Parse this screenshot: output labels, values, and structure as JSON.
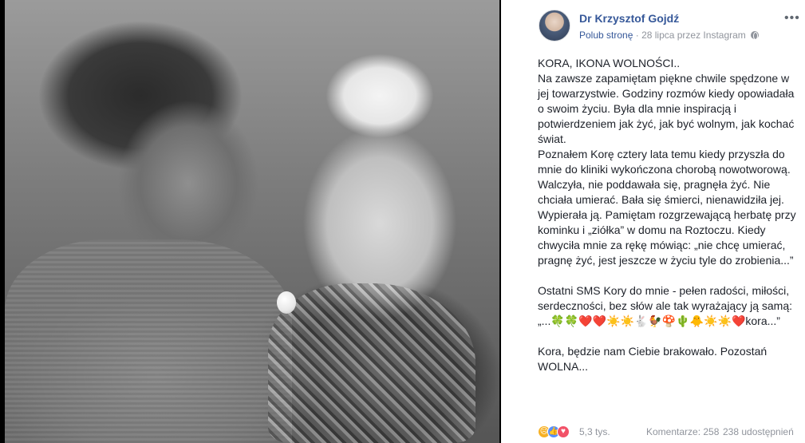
{
  "post": {
    "page_name": "Dr Krzysztof Gojdź",
    "like_page_label": "Polub stronę",
    "meta_separator": " · ",
    "date_via": "28 lipca przez Instagram",
    "privacy_icon": "globe-icon",
    "more_label": "•••",
    "text": "KORA, IKONA WOLNOŚCI..\nNa zawsze zapamiętam piękne chwile spędzone w jej towarzystwie. Godziny rozmów kiedy opowiadała o swoim życiu. Była dla mnie inspiracją i potwierdzeniem jak żyć, jak być wolnym, jak kochać świat.\nPoznałem Korę cztery lata temu kiedy przyszła do mnie do kliniki wykończona chorobą nowotworową. Walczyła, nie poddawała się, pragnęła żyć. Nie chciała umierać. Bała się śmierci, nienawidziła jej. Wypierała ją. Pamiętam rozgrzewającą herbatę przy kominku i „ziółka” w domu na Roztoczu. Kiedy chwyciła mnie za rękę mówiąc: „nie chcę umierać, pragnę żyć, jest jeszcze w życiu tyle do zrobienia...”\n\nOstatni SMS Kory do mnie - pełen radości, miłości, serdeczności, bez słów ale tak wyrażający ją samą: „...🍀🍀❤️❤️☀️☀️🐇🐓🍄🌵🐥☀️☀️❤️kora...”\n\nKora, będzie nam Ciebie brakowało. Pozostań WOLNA..."
  },
  "footer": {
    "reaction_icons": [
      "sad-reaction-icon",
      "like-reaction-icon",
      "love-reaction-icon"
    ],
    "reactions_count": "5,3 tys.",
    "comments": "Komentarze: 258",
    "shares": "238 udostępnień"
  },
  "colors": {
    "link": "#365899",
    "meta": "#90949c",
    "text": "#1d2129",
    "photo_bg": "#000000"
  }
}
